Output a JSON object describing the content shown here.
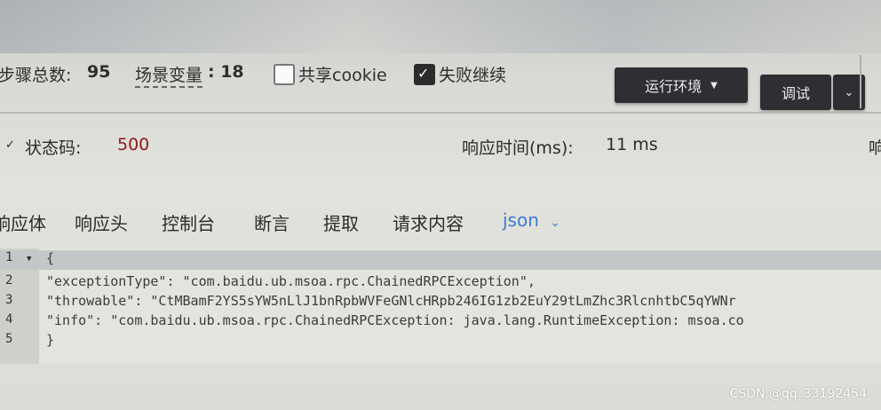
{
  "toolbar": {
    "steps_label": "步骤总数:",
    "steps_value": "95",
    "scene_vars_label": "场景变量",
    "scene_vars_value": ": 18",
    "share_cookie_label": "共享cookie",
    "fail_continue_label": "失败继续",
    "env_button": "运行环境",
    "debug_button": "调试"
  },
  "status": {
    "code_label": "状态码:",
    "code_value": "500",
    "time_label": "响应时间(ms):",
    "time_value": "11 ms",
    "cut_text": "响"
  },
  "tabs": [
    "响应体",
    "响应头",
    "控制台",
    "断言",
    "提取",
    "请求内容"
  ],
  "format_select": "json",
  "editor": {
    "lines": [
      {
        "num": "1",
        "text": "{"
      },
      {
        "num": "2",
        "text": "    \"exceptionType\": \"com.baidu.ub.msoa.rpc.ChainedRPCException\","
      },
      {
        "num": "3",
        "text": "    \"throwable\": \"CtMBamF2YS5sYW5nLlJ1bnRpbWVFeGNlcHRpb246IG1zb2EuY29tLmZhc3RlcnhtbC5qYWNr"
      },
      {
        "num": "4",
        "text": "    \"info\": \"com.baidu.ub.msoa.rpc.ChainedRPCException: java.lang.RuntimeException: msoa.co"
      },
      {
        "num": "5",
        "text": "}"
      }
    ]
  },
  "watermark": "CSDN @qq_33192454",
  "colors": {
    "status_code": "#8b1a1a",
    "json_link": "#3a7bd5",
    "dark_button": "#2d2f33"
  }
}
